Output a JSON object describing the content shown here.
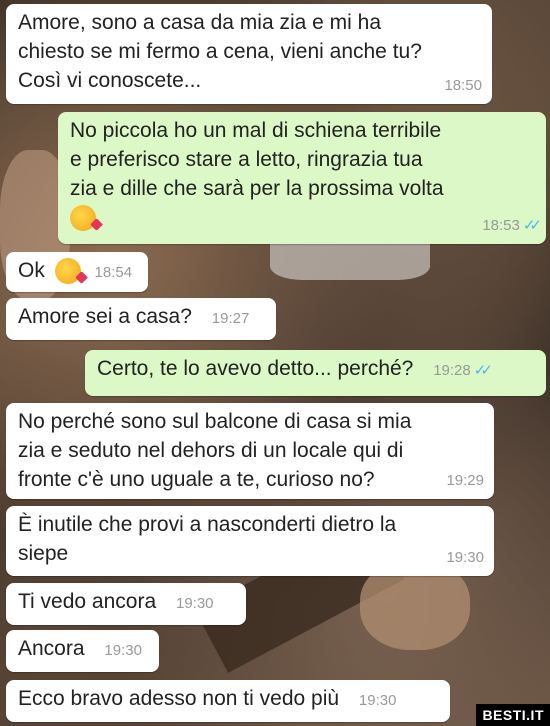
{
  "messages": [
    {
      "dir": "in",
      "text": "Amore, sono a casa da mia zia e mi ha\nchiesto se mi fermo a cena, vieni anche tu?\nCosì vi conoscete...",
      "time": "18:50"
    },
    {
      "dir": "out",
      "text": "No piccola ho un mal di schiena terribile\ne preferisco stare a letto, ringrazia tua\nzia e dille  che sarà per la prossima volta",
      "time": "18:53",
      "emoji": "kiss-face",
      "read": true
    },
    {
      "dir": "in",
      "text": "Ok",
      "time": "18:54",
      "emoji": "kiss-face"
    },
    {
      "dir": "in",
      "text": "Amore sei a casa?",
      "time": "19:27"
    },
    {
      "dir": "out",
      "text": "Certo, te lo avevo detto... perché?",
      "time": "19:28",
      "read": true
    },
    {
      "dir": "in",
      "text": "No perché sono sul balcone di casa si mia\nzia e seduto nel dehors di un locale qui di\nfronte c'è uno uguale a te, curioso no?",
      "time": "19:29"
    },
    {
      "dir": "in",
      "text": "È inutile che provi a nasconderti dietro la\nsiepe",
      "time": "19:30"
    },
    {
      "dir": "in",
      "text": "Ti vedo ancora",
      "time": "19:30"
    },
    {
      "dir": "in",
      "text": "Ancora",
      "time": "19:30"
    },
    {
      "dir": "in",
      "text": "Ecco bravo adesso non ti vedo più",
      "time": "19:30"
    }
  ],
  "watermark": "BESTI.IT",
  "colors": {
    "incoming": "#ffffff",
    "outgoing": "#dcf8c6",
    "read_ticks": "#4fb6ec"
  }
}
